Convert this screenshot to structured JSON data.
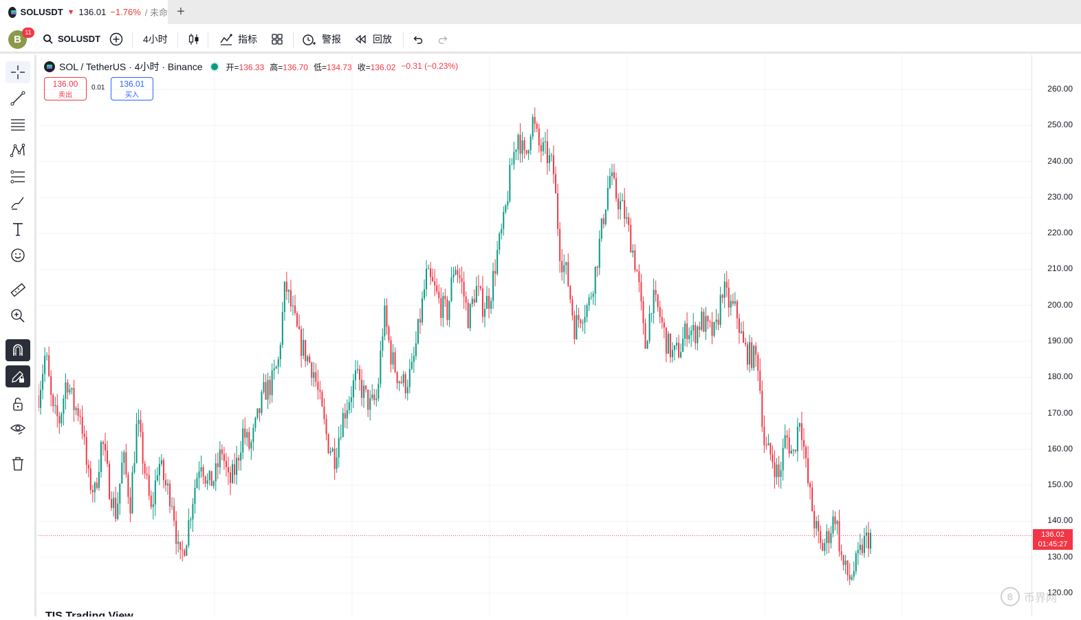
{
  "tab": {
    "symbol": "SOLUSDT",
    "direction": "▼",
    "price": "136.01",
    "change": "−1.76%",
    "rest": "/ 未命"
  },
  "toolbar": {
    "avatar_letter": "B",
    "notifications": "11",
    "symbol": "SOLUSDT",
    "interval": "4小时",
    "indicators_label": "指标",
    "alert_label": "警报",
    "replay_label": "回放"
  },
  "legend": {
    "title": "SOL / TetherUS · 4小时 · Binance",
    "open_label": "开=",
    "open": "136.33",
    "high_label": "高=",
    "high": "136.70",
    "low_label": "低=",
    "low": "134.73",
    "close_label": "收=",
    "close": "136.02",
    "change": "−0.31 (−0.23%)"
  },
  "trade": {
    "sell_price": "136.00",
    "sell_label": "卖出",
    "spread": "0.01",
    "buy_price": "136.01",
    "buy_label": "买入"
  },
  "price_tag": {
    "price": "136.02",
    "countdown": "01:45:27"
  },
  "watermark": "币界网",
  "bottom_text": "TIS Trading View",
  "colors": {
    "up": "#089981",
    "down": "#f23645",
    "accent": "#2962ff"
  },
  "chart_data": {
    "type": "candlestick",
    "ylim": [
      118,
      268
    ],
    "y_ticks": [
      "260.00",
      "250.00",
      "240.00",
      "230.00",
      "220.00",
      "210.00",
      "200.00",
      "190.00",
      "180.00",
      "170.00",
      "160.00",
      "150.00",
      "140.00",
      "130.00",
      "120.00"
    ],
    "close_path": [
      175,
      187,
      170,
      168,
      180,
      172,
      170,
      152,
      148,
      163,
      150,
      142,
      158,
      145,
      168,
      155,
      142,
      157,
      150,
      146,
      128,
      136,
      148,
      158,
      150,
      152,
      160,
      150,
      155,
      165,
      160,
      168,
      176,
      178,
      184,
      206,
      198,
      190,
      186,
      182,
      172,
      162,
      158,
      168,
      174,
      180,
      176,
      172,
      174,
      198,
      186,
      180,
      178,
      182,
      195,
      208,
      205,
      200,
      198,
      212,
      206,
      196,
      205,
      200,
      202,
      214,
      223,
      238,
      248,
      240,
      252,
      244,
      242,
      238,
      214,
      208,
      194,
      198,
      200,
      210,
      223,
      236,
      230,
      226,
      218,
      208,
      188,
      202,
      198,
      190,
      186,
      188,
      194,
      192,
      196,
      193,
      192,
      205,
      200,
      198,
      188,
      186,
      185,
      160,
      158,
      152,
      164,
      158,
      170,
      152,
      140,
      132,
      136,
      142,
      128,
      124,
      128,
      134,
      136
    ]
  }
}
